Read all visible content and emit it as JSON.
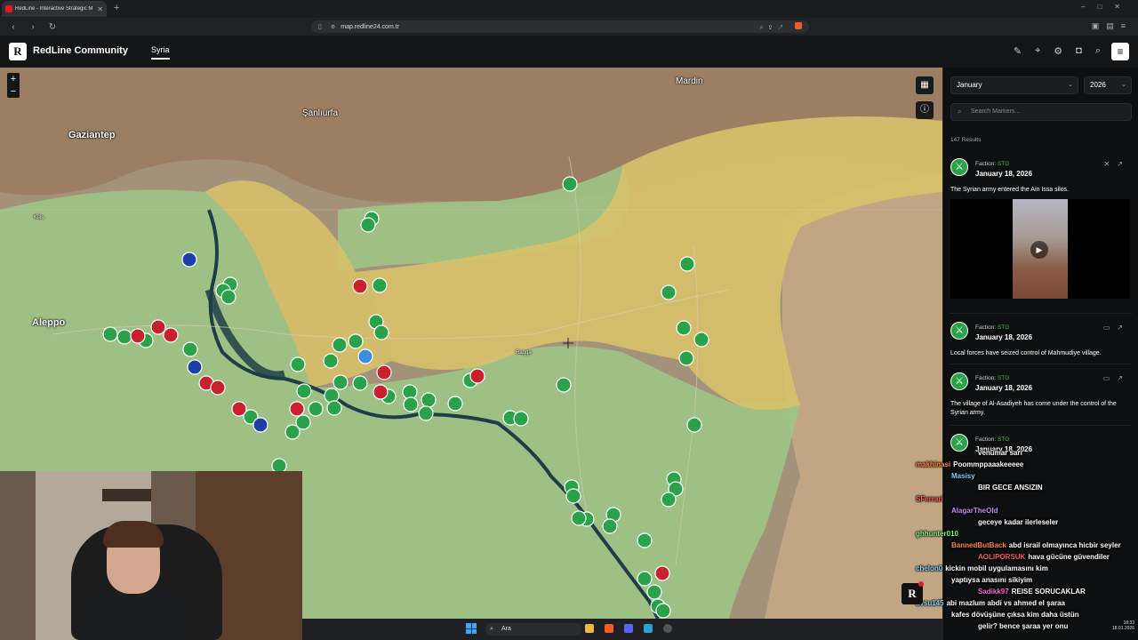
{
  "browser": {
    "tab_title": "RedLine - Interactive Strategic M",
    "tab_close": "✕",
    "new_tab": "+",
    "url": "map.redline24.com.tr",
    "back": "‹",
    "forward": "›",
    "reload": "↻"
  },
  "header": {
    "logo": "R",
    "brand": "RedLine Community",
    "region_tab": "Syria"
  },
  "map": {
    "zoom_in": "+",
    "zoom_out": "−",
    "labels": {
      "gaziantep": "Gaziantep",
      "aleppo": "Aleppo",
      "sanliurfa": "Şanlıurfa",
      "mardin": "Mardin",
      "kilis": "Kilis",
      "raqqa": "Raqqa"
    },
    "colors": {
      "sdf_zone": "#d8c36a",
      "gov_zone": "#8fc77a",
      "neutral": "#a89676",
      "marker_green": "#2aa24a",
      "marker_red": "#c8202c",
      "marker_blue": "#1f3fa8",
      "river": "#1f3d47"
    }
  },
  "sidebar": {
    "month": "January",
    "year": "2026",
    "search_placeholder": "Search Markers...",
    "results": "147 Results",
    "cards": [
      {
        "faction_label": "Faction:",
        "faction": "STG",
        "date": "January 18, 2026",
        "text": "The Syrian army entered the Ain Issa silos."
      },
      {
        "faction_label": "Faction:",
        "faction": "STG",
        "date": "January 18, 2026",
        "text": "Local forces have seized control of Mahmudiye village."
      },
      {
        "faction_label": "Faction:",
        "faction": "STG",
        "date": "January 18, 2026",
        "text": "The village of Al-Asadiyeh has come under the control of the Syrian army."
      },
      {
        "faction_label": "Faction:",
        "faction": "STG",
        "date": "January 18, 2026",
        "text": ""
      }
    ]
  },
  "chat": [
    {
      "user": "",
      "msg": "venümar sarı",
      "color": "#ffffff"
    },
    {
      "user": "makhinasi",
      "msg": "Poommppaaakeeeee",
      "color": "#ff8a3c"
    },
    {
      "user": "Masisy",
      "msg": "",
      "color": "#7fd3ff"
    },
    {
      "user": "",
      "msg": "BIR GECE ANSIZIN",
      "color": "#ffffff"
    },
    {
      "user": "SFerrari",
      "msg": "",
      "color": "#ff5b5b"
    },
    {
      "user": "AlagarTheOld",
      "msg": "",
      "color": "#c88cff"
    },
    {
      "user": "",
      "msg": "geceye kadar ilerleseler",
      "color": "#ffffff"
    },
    {
      "user": "ghhunter010",
      "msg": "",
      "color": "#7cff7c"
    },
    {
      "user": "BannedButBack",
      "msg": "abd israil olmayınca hicbir seyler",
      "color": "#ff8a3c"
    },
    {
      "user": "AOLIPORSUK",
      "msg": "hava gücüne güvendiler",
      "color": "#ff5b5b"
    },
    {
      "user": "chelon0",
      "msg": "kickin mobil uygulamasını kim",
      "color": "#7fd3ff"
    },
    {
      "user": "",
      "msg": "yaptıysa anasını sikiyim",
      "color": "#ffffff"
    },
    {
      "user": "Sadikk97",
      "msg": "REISE SORUCAKLAR",
      "color": "#ff6bd5"
    },
    {
      "user": "avsu145",
      "msg": "abi mazlum abdi vs ahmed el şaraa",
      "color": "#7fd3ff"
    },
    {
      "user": "",
      "msg": "kafes dövüşüne çıksa kim daha üstün",
      "color": "#ffffff"
    },
    {
      "user": "",
      "msg": "gelir? bence şaraa yer onu",
      "color": "#ffffff"
    }
  ],
  "taskbar": {
    "search": "Ara",
    "time": "18:33",
    "date": "18.01.2026"
  },
  "float_logo": "R"
}
